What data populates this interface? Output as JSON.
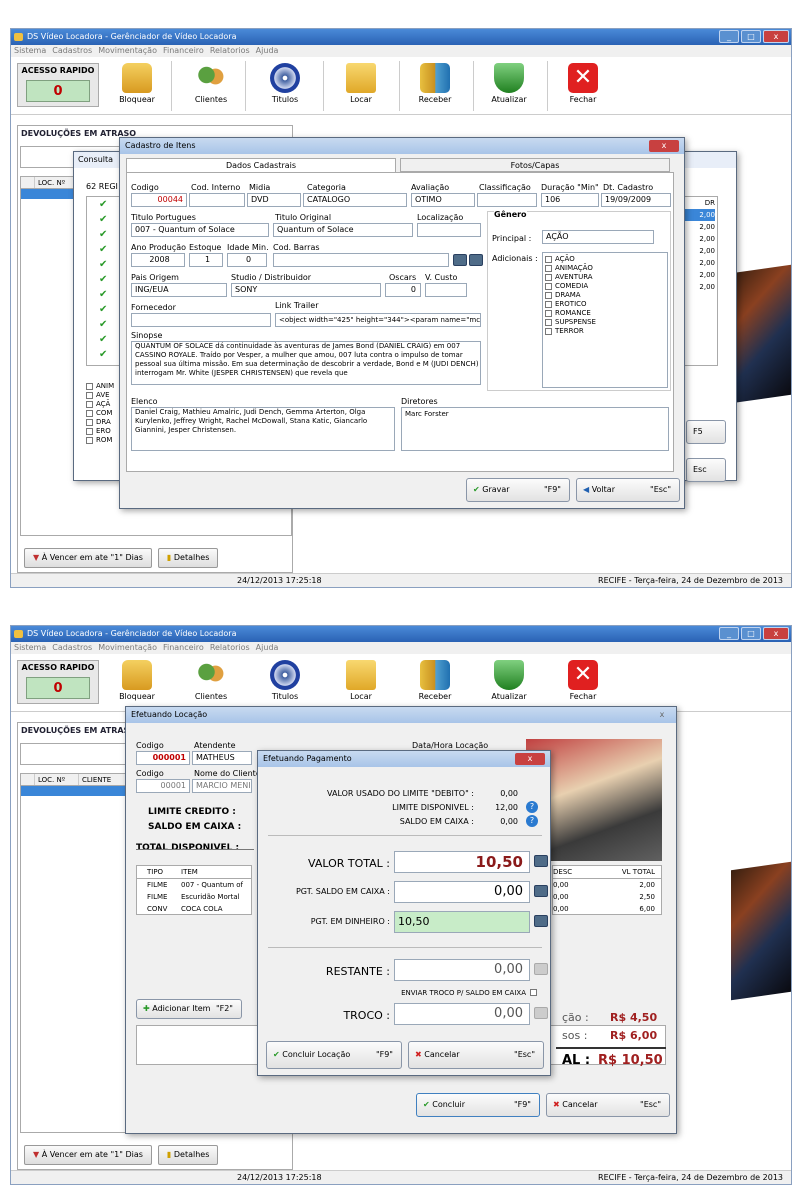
{
  "app": {
    "title": "DS Vídeo Locadora - Gerênciador de Vídeo Locadora",
    "menu": [
      "Sistema",
      "Cadastros",
      "Movimentação",
      "Financeiro",
      "Relatorios",
      "Ajuda"
    ],
    "quick_label": "ACESSO RAPIDO",
    "quick_value": "0",
    "toolbar": [
      "Bloquear",
      "Clientes",
      "Titulos",
      "Locar",
      "Receber",
      "Atualizar",
      "Fechar"
    ],
    "toolbar_icons": [
      "lock-icon",
      "clients-icon",
      "dvd-icon",
      "folder-icon",
      "coins-icon",
      "shield-icon",
      "close-icon"
    ],
    "left_title": "DEVOLUÇÕES EM ATRASO",
    "grid_cols": [
      "LOC. Nº",
      "CLIENTE"
    ],
    "btn_vencer": "À Vencer em ate \"1\" Dias",
    "btn_detalhes": "Detalhes",
    "status_datetime": "24/12/2013 17:25:18",
    "status_city": "RECIFE - Terça-feira, 24 de Dezembro de 2013"
  },
  "shot1": {
    "consulta_title": "Consulta",
    "consulta_count": "62 REGI",
    "genres_left": [
      "ANIM",
      "AVE",
      "AÇÃ",
      "COM",
      "DRA",
      "ERO",
      "ROM"
    ],
    "right_col": "DR",
    "right_vals": [
      "2,00",
      "2,00",
      "2,00",
      "2,00",
      "2,00",
      "2,00",
      "2,00",
      "2,00",
      "2,00"
    ],
    "f5": "F5",
    "esc": "Esc",
    "dialog": {
      "title": "Cadastro de Itens",
      "tab1": "Dados Cadastrais",
      "tab2": "Fotos/Capas",
      "labels": {
        "codigo": "Codigo",
        "cod_interno": "Cod. Interno",
        "midia": "Midia",
        "categoria": "Categoria",
        "avaliacao": "Avaliação",
        "classificacao": "Classificação",
        "duracao": "Duração \"Min\"",
        "dt_cadastro": "Dt. Cadastro",
        "titulo_pt": "Titulo Portugues",
        "titulo_orig": "Titulo Original",
        "localizacao": "Localização",
        "ano": "Ano Produção",
        "estoque": "Estoque",
        "idade": "Idade Min.",
        "cod_barras": "Cod. Barras",
        "pais": "Pais Origem",
        "studio": "Studio / Distribuidor",
        "oscars": "Oscars",
        "vcusto": "V. Custo",
        "fornecedor": "Fornecedor",
        "link": "Link Trailer",
        "sinopse": "Sinopse",
        "elenco": "Elenco",
        "diretores": "Diretores",
        "genero": "Gênero",
        "principal": "Principal :",
        "adicionais": "Adicionais :"
      },
      "values": {
        "codigo": "00044",
        "midia": "DVD",
        "categoria": "CATALOGO",
        "avaliacao": "OTIMO",
        "duracao": "106",
        "dt_cadastro": "19/09/2009",
        "titulo_pt": "007 - Quantum of Solace",
        "titulo_orig": "Quantum of Solace",
        "ano": "2008",
        "estoque": "1",
        "idade": "0",
        "pais": "ING/EUA",
        "studio": "SONY",
        "oscars": "0",
        "link": "<object width=\"425\" height=\"344\"><param name=\"mc",
        "principal": "AÇÃO",
        "sinopse": "QUANTUM OF SOLACE dá continuidade às aventuras de James Bond (DANIEL CRAIG) em 007 CASSINO ROYALE. Traído por Vesper, a mulher que amou, 007 luta contra o impulso de tomar pessoal sua última missão. Em sua determinação de descobrir a verdade, Bond e M (JUDI DENCH) interrogam Mr. White (JESPER CHRISTENSEN) que revela que",
        "elenco": "Daniel Craig, Mathieu Amalric, Judi Dench, Gemma Arterton, Olga Kurylenko, Jeffrey Wright, Rachel McDowall, Stana Katic, Giancarlo Giannini, Jesper Christensen.",
        "diretores": "Marc Forster"
      },
      "generos": [
        "AÇÃO",
        "ANIMAÇÃO",
        "AVENTURA",
        "COMEDIA",
        "DRAMA",
        "EROTICO",
        "ROMANCE",
        "SUPSPENSE",
        "TERROR"
      ],
      "gravar": "Gravar",
      "gravar_key": "\"F9\"",
      "voltar": "Voltar",
      "voltar_key": "\"Esc\""
    }
  },
  "shot2": {
    "loc": {
      "title": "Efetuando Locação",
      "codigo_lbl": "Codigo",
      "atendente_lbl": "Atendente",
      "datahora_lbl": "Data/Hora Locação",
      "codigo": "000001",
      "atendente": "MATHEUS",
      "codigo2_lbl": "Codigo",
      "nome_lbl": "Nome do Cliente",
      "codigo2": "00001",
      "nome": "MARCIO MENI",
      "limite": "LIMITE CREDITO :",
      "saldo": "SALDO EM CAIXA :",
      "total_disp": "TOTAL DISPONIVEL :",
      "cols": [
        "TIPO",
        "ITEM"
      ],
      "rows": [
        [
          "FILME",
          "007 - Quantum of"
        ],
        [
          "FILME",
          "Escuridão Mortal"
        ],
        [
          "CONV",
          "COCA COLA"
        ]
      ],
      "cols_r": [
        "DESC",
        "VL TOTAL"
      ],
      "rows_r": [
        [
          "0,00",
          "2,00"
        ],
        [
          "0,00",
          "2,50"
        ],
        [
          "0,00",
          "6,00"
        ]
      ],
      "adicionar": "Adicionar Item",
      "adicionar_key": "\"F2\"",
      "sum1_lbl": "ção :",
      "sum1": "R$ 4,50",
      "sum2_lbl": "sos :",
      "sum2": "R$ 6,00",
      "sum3_lbl": "AL :",
      "sum3": "R$ 10,50",
      "concluir": "Concluir",
      "concluir_key": "\"F9\"",
      "cancelar": "Cancelar",
      "cancelar_key": "\"Esc\""
    },
    "pag": {
      "title": "Efetuando Pagamento",
      "l1": "VALOR USADO DO LIMITE \"DEBITO\" :",
      "v1": "0,00",
      "l2": "LIMITE DISPONIVEL :",
      "v2": "12,00",
      "l3": "SALDO EM CAIXA :",
      "v3": "0,00",
      "total_lbl": "VALOR TOTAL :",
      "total": "10,50",
      "saldo_lbl": "PGT. SALDO EM CAIXA :",
      "saldo": "0,00",
      "dinheiro_lbl": "PGT. EM DINHEIRO :",
      "dinheiro": "10,50",
      "restante_lbl": "RESTANTE :",
      "restante": "0,00",
      "enviar": "ENVIAR TROCO P/ SALDO EM CAIXA",
      "troco_lbl": "TROCO :",
      "troco": "0,00",
      "concluir": "Concluir Locação",
      "concluir_key": "\"F9\"",
      "cancelar": "Cancelar",
      "cancelar_key": "\"Esc\""
    }
  }
}
